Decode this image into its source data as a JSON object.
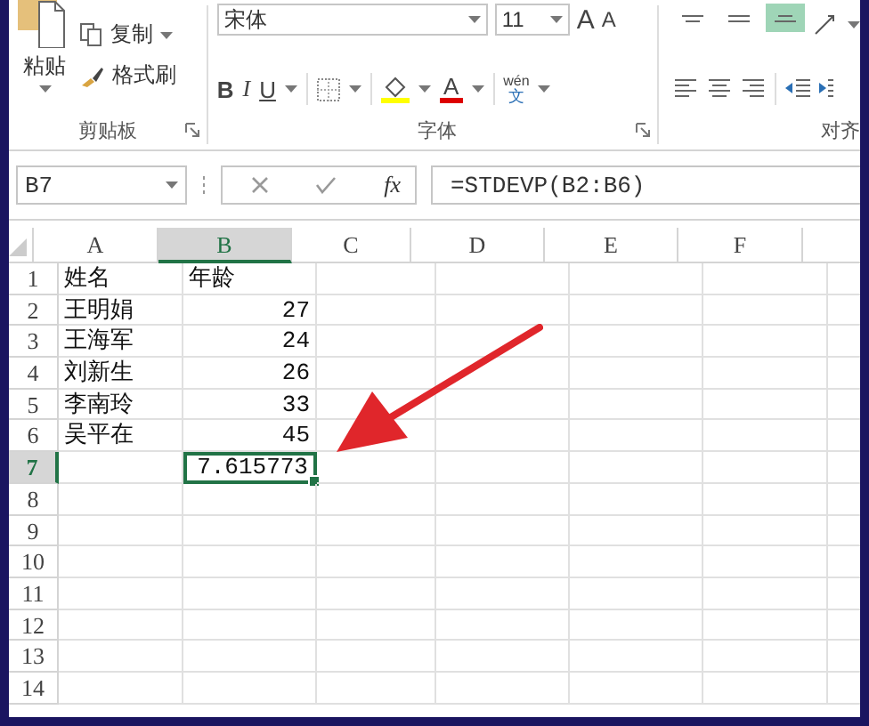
{
  "ribbon": {
    "clipboard": {
      "paste": "粘贴",
      "copy": "复制",
      "format_painter": "格式刷",
      "label": "剪贴板"
    },
    "font": {
      "font_name": "宋体",
      "font_size": "11",
      "grow": "A",
      "shrink": "A",
      "bold": "B",
      "italic": "I",
      "underline": "U",
      "font_color": "A",
      "phonetic_top": "wén",
      "phonetic_bottom": "文",
      "label": "字体"
    },
    "alignment": {
      "top_buttons": [
        {
          "kind": "top",
          "selected": false
        },
        {
          "kind": "middle",
          "selected": false
        },
        {
          "kind": "bottom",
          "selected": true
        }
      ],
      "label": "对齐"
    }
  },
  "formula_bar": {
    "name_box": "B7",
    "function_button": "fx",
    "formula": "=STDEVP(B2:B6)"
  },
  "columns": [
    {
      "label": "A",
      "selected": false
    },
    {
      "label": "B",
      "selected": true
    },
    {
      "label": "C",
      "selected": false
    },
    {
      "label": "D",
      "selected": false
    },
    {
      "label": "E",
      "selected": false
    },
    {
      "label": "F",
      "selected": false
    }
  ],
  "rows": [
    {
      "header": "1",
      "selected": false,
      "cells": [
        {
          "text": "姓名",
          "kind": "text"
        },
        {
          "text": "年龄",
          "kind": "text"
        }
      ]
    },
    {
      "header": "2",
      "selected": false,
      "cells": [
        {
          "text": "王明娟",
          "kind": "text"
        },
        {
          "text": "27",
          "kind": "number"
        }
      ]
    },
    {
      "header": "3",
      "selected": false,
      "cells": [
        {
          "text": "王海军",
          "kind": "text"
        },
        {
          "text": "24",
          "kind": "number"
        }
      ]
    },
    {
      "header": "4",
      "selected": false,
      "cells": [
        {
          "text": "刘新生",
          "kind": "text"
        },
        {
          "text": "26",
          "kind": "number"
        }
      ]
    },
    {
      "header": "5",
      "selected": false,
      "cells": [
        {
          "text": "李南玲",
          "kind": "text"
        },
        {
          "text": "33",
          "kind": "number"
        }
      ]
    },
    {
      "header": "6",
      "selected": false,
      "cells": [
        {
          "text": "吴平在",
          "kind": "text"
        },
        {
          "text": "45",
          "kind": "number"
        }
      ]
    },
    {
      "header": "7",
      "selected": true,
      "cells": [
        {
          "kind": "empty"
        },
        {
          "text": "7.615773",
          "kind": "number",
          "active": true
        }
      ]
    },
    {
      "header": "8",
      "selected": false,
      "cells": []
    },
    {
      "header": "9",
      "selected": false,
      "cells": []
    },
    {
      "header": "10",
      "selected": false,
      "cells": []
    },
    {
      "header": "11",
      "selected": false,
      "cells": []
    },
    {
      "header": "12",
      "selected": false,
      "cells": []
    },
    {
      "header": "13",
      "selected": false,
      "cells": []
    },
    {
      "header": "14",
      "selected": false,
      "cells": []
    }
  ]
}
